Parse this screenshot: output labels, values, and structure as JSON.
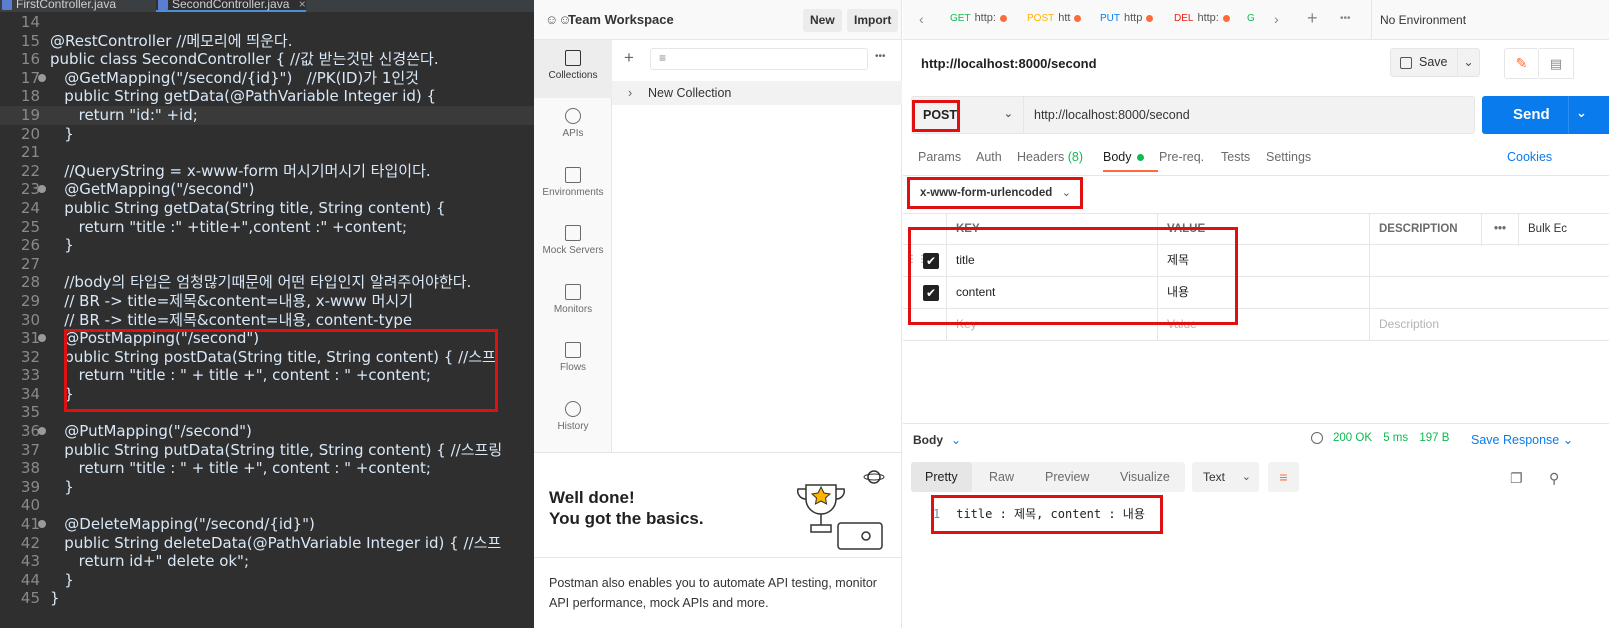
{
  "editor": {
    "tabs": [
      {
        "label": "FirstController.java"
      },
      {
        "label": "SecondController.java"
      }
    ],
    "close_glyph": "×",
    "lines": [
      {
        "n": "14",
        "code": ""
      },
      {
        "n": "15",
        "code": "@RestController //메모리에 띄운다."
      },
      {
        "n": "16",
        "code": "public class SecondController { //값 받는것만 신경쓴다."
      },
      {
        "n": "17",
        "code": "   @GetMapping(\"/second/{id}\")   //PK(ID)가 1인것"
      },
      {
        "n": "18",
        "code": "   public String getData(@PathVariable Integer id) {"
      },
      {
        "n": "19",
        "code": "      return \"id:\" +id;"
      },
      {
        "n": "20",
        "code": "   }"
      },
      {
        "n": "21",
        "code": ""
      },
      {
        "n": "22",
        "code": "   //QueryString = x-www-form 머시기머시기 타입이다."
      },
      {
        "n": "23",
        "code": "   @GetMapping(\"/second\")"
      },
      {
        "n": "24",
        "code": "   public String getData(String title, String content) {"
      },
      {
        "n": "25",
        "code": "      return \"title :\" +title+\",content :\" +content;"
      },
      {
        "n": "26",
        "code": "   }"
      },
      {
        "n": "27",
        "code": ""
      },
      {
        "n": "28",
        "code": "   //body의 타입은 엄청많기때문에 어떤 타입인지 알려주어야한다."
      },
      {
        "n": "29",
        "code": "   // BR -> title=제목&content=내용, x-www 머시기"
      },
      {
        "n": "30",
        "code": "   // BR -> title=제목&content=내용, content-type"
      },
      {
        "n": "31",
        "code": "   @PostMapping(\"/second\")"
      },
      {
        "n": "32",
        "code": "   public String postData(String title, String content) { //스프"
      },
      {
        "n": "33",
        "code": "      return \"title : \" + title +\", content : \" +content;"
      },
      {
        "n": "34",
        "code": "   }"
      },
      {
        "n": "35",
        "code": ""
      },
      {
        "n": "36",
        "code": "   @PutMapping(\"/second\")"
      },
      {
        "n": "37",
        "code": "   public String putData(String title, String content) { //스프링"
      },
      {
        "n": "38",
        "code": "      return \"title : \" + title +\", content : \" +content;"
      },
      {
        "n": "39",
        "code": "   }"
      },
      {
        "n": "40",
        "code": ""
      },
      {
        "n": "41",
        "code": "   @DeleteMapping(\"/second/{id}\")"
      },
      {
        "n": "42",
        "code": "   public String deleteData(@PathVariable Integer id) { //스프"
      },
      {
        "n": "43",
        "code": "      return id+\" delete ok\";"
      },
      {
        "n": "44",
        "code": "   }"
      },
      {
        "n": "45",
        "code": "}"
      }
    ]
  },
  "workspace": {
    "title": "Team Workspace",
    "new_label": "New",
    "import_label": "Import"
  },
  "sidebar": {
    "items": [
      {
        "label": "Collections"
      },
      {
        "label": "APIs"
      },
      {
        "label": "Environments"
      },
      {
        "label": "Mock Servers"
      },
      {
        "label": "Monitors"
      },
      {
        "label": "Flows"
      },
      {
        "label": "History"
      }
    ]
  },
  "collections": {
    "plus": "+",
    "more": "•••",
    "item": "New Collection"
  },
  "welldone": {
    "title": "Well done!\nYou got the basics.",
    "text": "Postman also enables you to automate API testing, monitor API performance, mock APIs and more."
  },
  "tabs": {
    "items": [
      {
        "method": "GET",
        "label": "http:",
        "color": "#0cbb52"
      },
      {
        "method": "POST",
        "label": "htt",
        "color": "#ffb400"
      },
      {
        "method": "PUT",
        "label": "http",
        "color": "#097bed"
      },
      {
        "method": "DEL",
        "label": "http:",
        "color": "#eb2013"
      },
      {
        "method": "GI",
        "label": "",
        "color": "#0cbb52"
      }
    ],
    "env": "No Environment",
    "plus": "+",
    "more": "•••",
    "prev": "‹",
    "next": "›"
  },
  "request": {
    "title": "http://localhost:8000/second",
    "save_label": "Save",
    "method": "POST",
    "url": "http://localhost:8000/second",
    "send_label": "Send",
    "chevron": "⌄",
    "tabs": {
      "params": "Params",
      "auth": "Auth",
      "headers": "Headers",
      "headers_count": "(8)",
      "body": "Body",
      "prereq": "Pre-req.",
      "tests": "Tests",
      "settings": "Settings",
      "cookies": "Cookies"
    },
    "body_type": "x-www-form-urlencoded",
    "table": {
      "headers": {
        "key": "KEY",
        "value": "VALUE",
        "description": "DESCRIPTION",
        "more": "•••",
        "bulk": "Bulk Ec"
      },
      "rows": [
        {
          "key": "title",
          "value": "제목"
        },
        {
          "key": "content",
          "value": "내용"
        }
      ],
      "placeholder": {
        "key": "Key",
        "value": "Value",
        "description": "Description"
      },
      "check": "✔"
    }
  },
  "response": {
    "body_label": "Body",
    "status": "200 OK",
    "time": "5 ms",
    "size": "197 B",
    "save_label": "Save Response",
    "views": [
      "Pretty",
      "Raw",
      "Preview",
      "Visualize"
    ],
    "format": "Text",
    "line_number": "1",
    "line_text": "title : 제목, content : 내용"
  },
  "colors": {
    "accent": "#ff6c37",
    "send": "#097bed",
    "highlight": "#e01010"
  }
}
